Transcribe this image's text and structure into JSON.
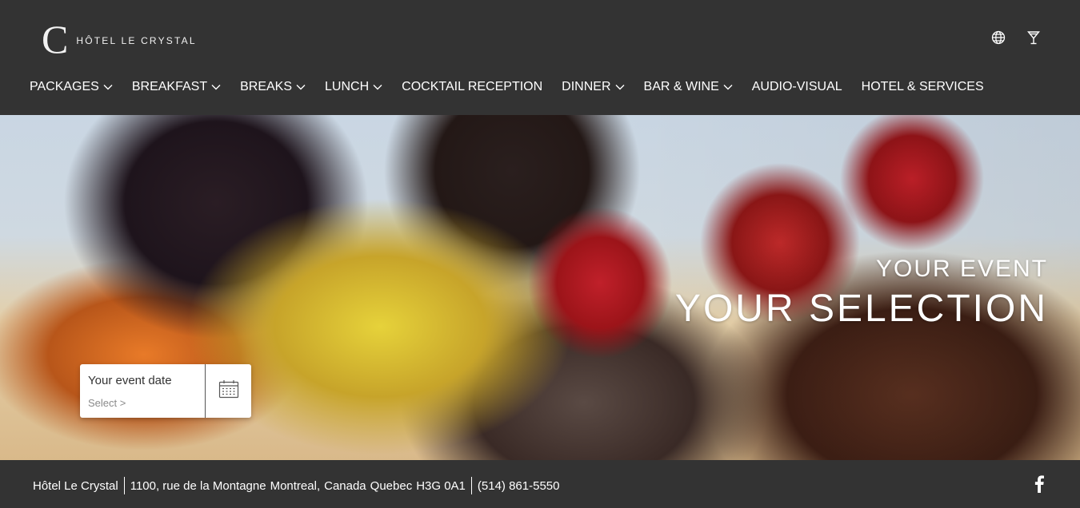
{
  "brand": {
    "mark": "C",
    "name": "HÔTEL LE CRYSTAL"
  },
  "top_icons": [
    "globe-icon",
    "cocktail-glass-icon"
  ],
  "nav": {
    "items": [
      {
        "label": "PACKAGES",
        "has_dropdown": true
      },
      {
        "label": "BREAKFAST",
        "has_dropdown": true
      },
      {
        "label": "BREAKS",
        "has_dropdown": true
      },
      {
        "label": "LUNCH",
        "has_dropdown": true
      },
      {
        "label": "COCKTAIL RECEPTION",
        "has_dropdown": false
      },
      {
        "label": "DINNER",
        "has_dropdown": true
      },
      {
        "label": "BAR & WINE",
        "has_dropdown": true
      },
      {
        "label": "AUDIO-VISUAL",
        "has_dropdown": false
      },
      {
        "label": "HOTEL & SERVICES",
        "has_dropdown": false
      }
    ]
  },
  "hero": {
    "subtitle": "YOUR EVENT",
    "title": "YOUR SELECTION"
  },
  "event_date": {
    "label": "Your event date",
    "select_text": "Select >",
    "icon": "calendar-icon"
  },
  "footer": {
    "hotel_name": "Hôtel Le Crystal",
    "street": "1100, rue de la Montagne",
    "city": "Montreal,",
    "country": "Canada",
    "province": "Quebec",
    "postal_code": "H3G 0A1",
    "phone": "(514) 861-5550",
    "social_icon": "facebook-icon"
  },
  "colors": {
    "header_bg": "#333333",
    "footer_bg": "#333333",
    "text_light": "#ffffff"
  }
}
